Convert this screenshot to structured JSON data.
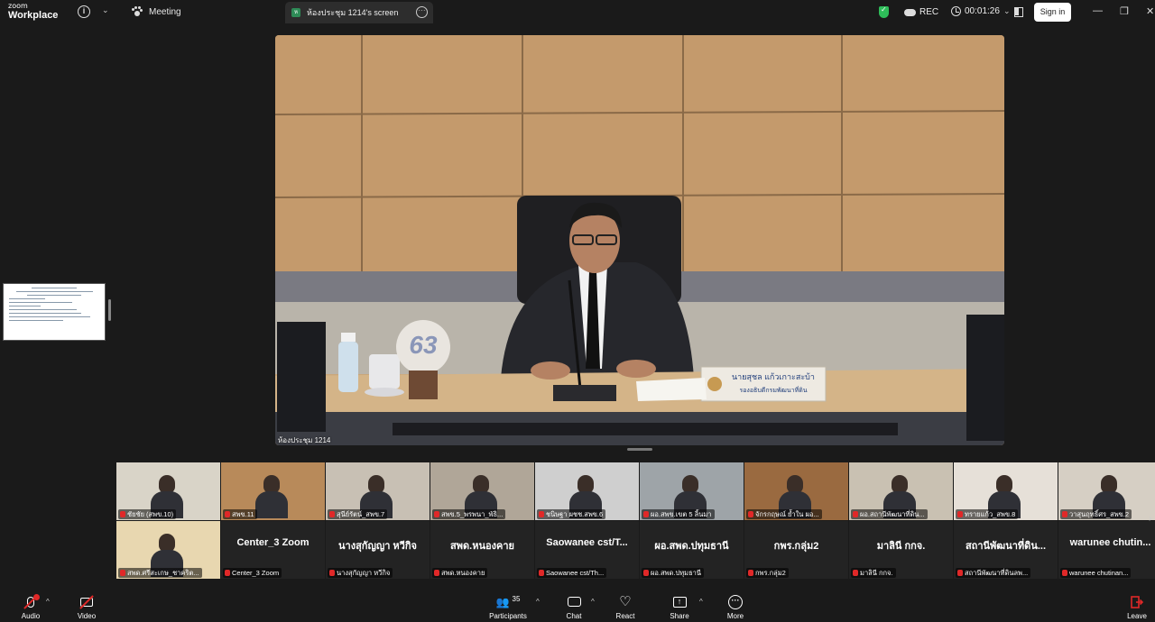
{
  "app": {
    "logo_top": "zoom",
    "logo_bottom": "Workplace",
    "info_icon": "info-icon",
    "meeting_label": "Meeting",
    "screen_tab_label": "ห้องประชุม 1214's screen",
    "screen_tab_badge": "ห",
    "rec_label": "REC",
    "timer": "00:01:26",
    "sign_in": "Sign in"
  },
  "main_video": {
    "label": "ห้องประชุม 1214",
    "nameplate_line1": "นายสุชล  แก้วเกาะสะบ้า",
    "nameplate_line2": "รองอธิบดีกรมพัฒนาที่ดิน",
    "logo_text": "63"
  },
  "gallery": {
    "row1": [
      {
        "name": "ชัยชัย (สพข.10)",
        "bg": "#d9d4c8"
      },
      {
        "name": "สพข.11",
        "bg": "#b88a5a"
      },
      {
        "name": "สุนีย์รัตน์_สพข.7",
        "bg": "#c8c0b4"
      },
      {
        "name": "สพข.5_พรพนา_พัธิ...",
        "bg": "#b0a698"
      },
      {
        "name": "ชนิษฐา ผชช.สพข.6",
        "bg": "#cfcfcf"
      },
      {
        "name": "ผอ.สพข.เขต 5 ลิ้นมา",
        "bg": "#9ea4a8"
      },
      {
        "name": "จักรกฤษณ์ ย้ำใน ผอ...",
        "bg": "#9a6a40"
      },
      {
        "name": "ผอ.สถานีพัฒนาที่ดิน...",
        "bg": "#c9c1b2"
      },
      {
        "name": "ทรายแก้ว_สพข.8",
        "bg": "#e6e0d8"
      },
      {
        "name": "วาสุนฤทธิ์ศร_สพข.2",
        "bg": "#d6cfc4"
      }
    ],
    "row2": [
      {
        "big": "",
        "name": "สพด.ศรีสะเกษ_ชาคริต...",
        "bg": "#e8d7b0",
        "video": true
      },
      {
        "big": "Center_3 Zoom",
        "name": "Center_3 Zoom"
      },
      {
        "big": "นางสุกัญญา หวีกิจ",
        "name": "นางสุกัญญา หวีกิจ"
      },
      {
        "big": "สพด.หนองคาย",
        "name": "สพด.หนองคาย"
      },
      {
        "big": "Saowanee cst/T...",
        "name": "Saowanee cst/Th..."
      },
      {
        "big": "ผอ.สพด.ปทุมธานี",
        "name": "ผอ.สพด.ปทุมธานี"
      },
      {
        "big": "กพร.กลุ่ม2",
        "name": "กพร.กลุ่ม2"
      },
      {
        "big": "มาลินี กกจ.",
        "name": "มาลินี กกจ."
      },
      {
        "big": "สถานีพัฒนาที่ดิน...",
        "name": "สถานีพัฒนาที่ดินลพ..."
      },
      {
        "big": "warunee chutin...",
        "name": "warunee chutinan..."
      }
    ]
  },
  "toolbar": {
    "audio": "Audio",
    "video": "Video",
    "participants": "Participants",
    "participants_count": "35",
    "chat": "Chat",
    "react": "React",
    "share": "Share",
    "more": "More",
    "leave": "Leave"
  }
}
